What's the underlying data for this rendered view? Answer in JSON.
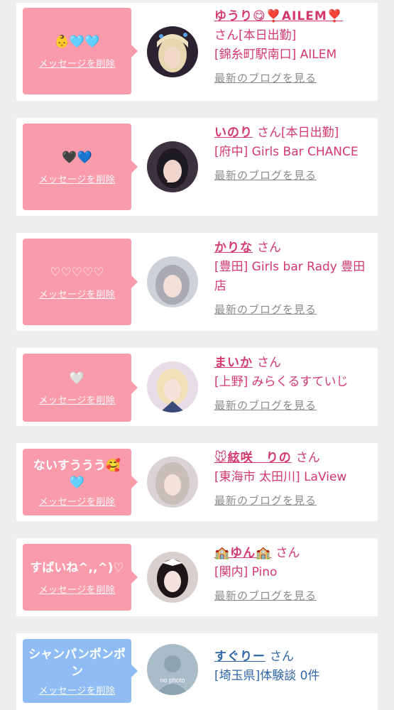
{
  "delete_label": "メッセージを削除",
  "blog_label": "最新のブログを見る",
  "colors": {
    "pink_bubble": "#f99bab",
    "blue_bubble": "#8fbdf3",
    "pink_text": "#d33a6b",
    "blue_text": "#2f66a8",
    "link_gray": "#8a8a8a"
  },
  "cards": [
    {
      "message": "👶🩵🩵",
      "name": "ゆうり😋❣️AILEM❣️",
      "suffix": "さん[本日出勤]",
      "location": "[錦糸町駅南口] AILEM",
      "avatar": "blonde-girl-photo"
    },
    {
      "message": "🖤💙",
      "name": "いのり",
      "suffix": "さん[本日出勤]",
      "location": "[府中] Girls Bar CHANCE",
      "avatar": "girl-peace-sign-photo"
    },
    {
      "message": "♡♡♡♡♡",
      "name": "かりな",
      "suffix": "さん",
      "location": "[豊田] Girls bar Rady 豊田店",
      "avatar": "silver-hair-girl-photo"
    },
    {
      "message": "🤍",
      "name": "まいか",
      "suffix": "さん",
      "location": "[上野] みらくるすていじ",
      "avatar": "blonde-uniform-girl-photo"
    },
    {
      "message": "ないすううう🥰🩵",
      "name": "🐭絃咲　りの",
      "suffix": "さん",
      "location": "[東海市 太田川] LaView",
      "avatar": "light-hair-girl-photo"
    },
    {
      "message": "すばいね^,,^)♡",
      "name": "🏫ゆん🏫",
      "suffix": "さん",
      "location": "[関内] Pino",
      "avatar": "dark-hair-girl-photo"
    },
    {
      "message": "シャンパンポンポン",
      "name": "すぐりー",
      "suffix": "さん",
      "location": "[埼玉県]体験談 0件",
      "avatar": "no-photo-placeholder",
      "avatar_text": "no photo"
    }
  ]
}
